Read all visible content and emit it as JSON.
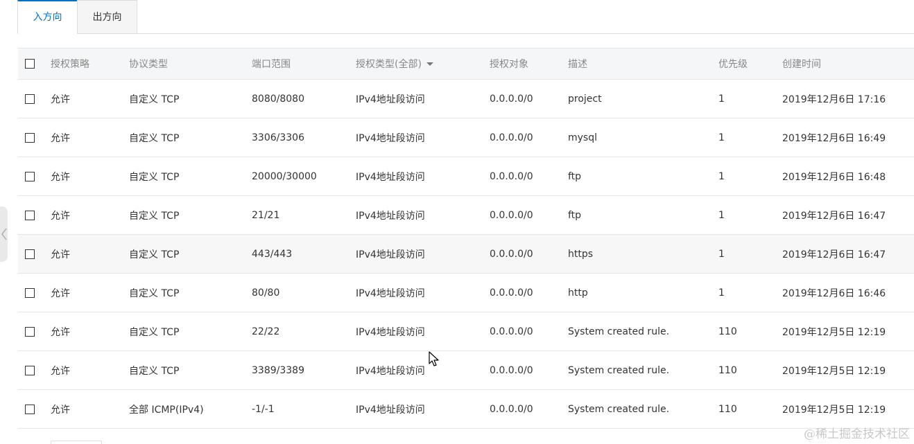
{
  "tabs": [
    {
      "label": "入方向",
      "active": true
    },
    {
      "label": "出方向",
      "active": false
    }
  ],
  "columns": {
    "policy": "授权策略",
    "protocol": "协议类型",
    "port": "端口范围",
    "auth_type": "授权类型(全部)",
    "object": "授权对象",
    "description": "描述",
    "priority": "优先级",
    "created": "创建时间"
  },
  "rows": [
    {
      "policy": "允许",
      "protocol": "自定义 TCP",
      "port": "8080/8080",
      "auth_type": "IPv4地址段访问",
      "object": "0.0.0.0/0",
      "description": "project",
      "priority": "1",
      "created": "2019年12月6日 17:16"
    },
    {
      "policy": "允许",
      "protocol": "自定义 TCP",
      "port": "3306/3306",
      "auth_type": "IPv4地址段访问",
      "object": "0.0.0.0/0",
      "description": "mysql",
      "priority": "1",
      "created": "2019年12月6日 16:49"
    },
    {
      "policy": "允许",
      "protocol": "自定义 TCP",
      "port": "20000/30000",
      "auth_type": "IPv4地址段访问",
      "object": "0.0.0.0/0",
      "description": "ftp",
      "priority": "1",
      "created": "2019年12月6日 16:48"
    },
    {
      "policy": "允许",
      "protocol": "自定义 TCP",
      "port": "21/21",
      "auth_type": "IPv4地址段访问",
      "object": "0.0.0.0/0",
      "description": "ftp",
      "priority": "1",
      "created": "2019年12月6日 16:47"
    },
    {
      "policy": "允许",
      "protocol": "自定义 TCP",
      "port": "443/443",
      "auth_type": "IPv4地址段访问",
      "object": "0.0.0.0/0",
      "description": "https",
      "priority": "1",
      "created": "2019年12月6日 16:47"
    },
    {
      "policy": "允许",
      "protocol": "自定义 TCP",
      "port": "80/80",
      "auth_type": "IPv4地址段访问",
      "object": "0.0.0.0/0",
      "description": "http",
      "priority": "1",
      "created": "2019年12月6日 16:46"
    },
    {
      "policy": "允许",
      "protocol": "自定义 TCP",
      "port": "22/22",
      "auth_type": "IPv4地址段访问",
      "object": "0.0.0.0/0",
      "description": "System created rule.",
      "priority": "110",
      "created": "2019年12月5日 12:19"
    },
    {
      "policy": "允许",
      "protocol": "自定义 TCP",
      "port": "3389/3389",
      "auth_type": "IPv4地址段访问",
      "object": "0.0.0.0/0",
      "description": "System created rule.",
      "priority": "110",
      "created": "2019年12月5日 12:19"
    },
    {
      "policy": "允许",
      "protocol": "全部 ICMP(IPv4)",
      "port": "-1/-1",
      "auth_type": "IPv4地址段访问",
      "object": "0.0.0.0/0",
      "description": "System created rule.",
      "priority": "110",
      "created": "2019年12月5日 12:19"
    }
  ],
  "watermark": "@稀土掘金技术社区",
  "icons": {
    "header_checkbox": "checkbox-icon",
    "sort": "caret-down-icon",
    "side_handle": "chevron-left-icon",
    "cursor": "mouse-pointer-icon"
  },
  "colors": {
    "accent": "#0070cc",
    "header_bg": "#f5f6f7",
    "border": "#e5e5e5"
  }
}
